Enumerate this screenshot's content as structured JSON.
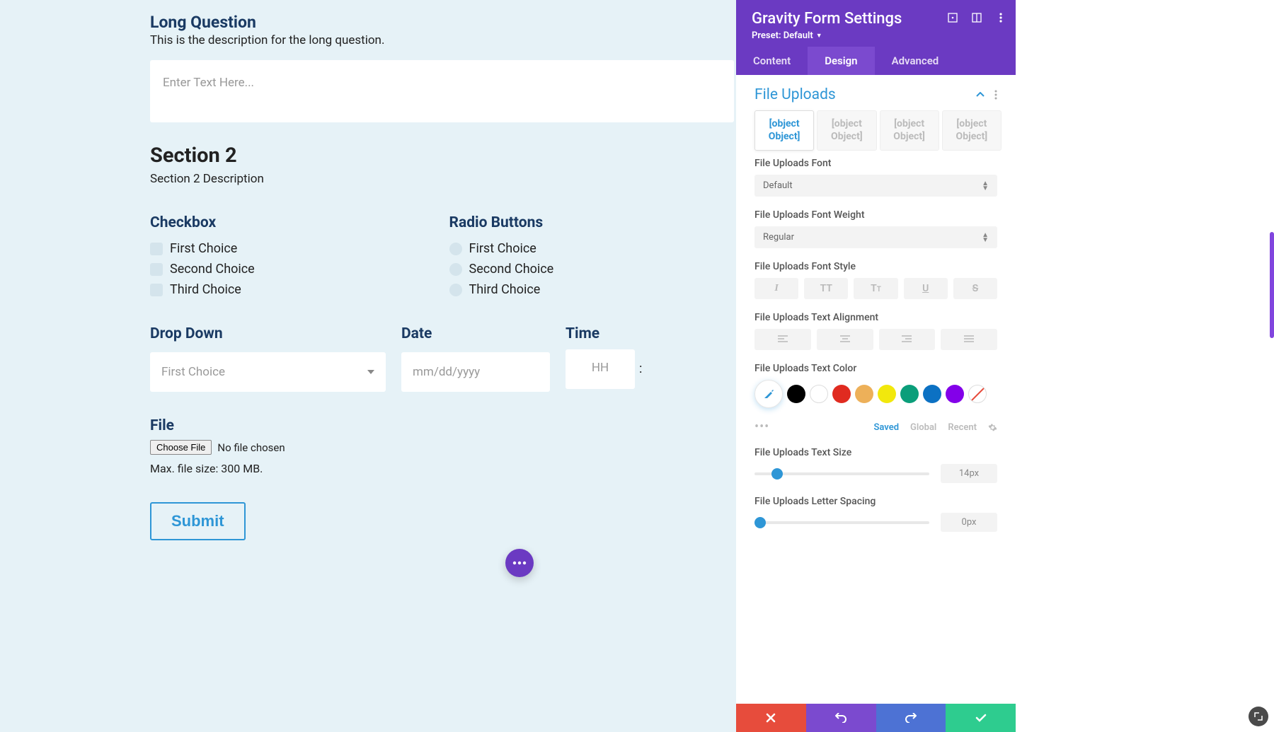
{
  "form": {
    "long_q_title": "Long Question",
    "long_q_desc": "This is the description for the long question.",
    "long_q_placeholder": "Enter Text Here...",
    "section2_title": "Section 2",
    "section2_desc": "Section 2 Description",
    "checkbox_label": "Checkbox",
    "checkbox_items": [
      "First Choice",
      "Second Choice",
      "Third Choice"
    ],
    "radio_label": "Radio Buttons",
    "radio_items": [
      "First Choice",
      "Second Choice",
      "Third Choice"
    ],
    "dropdown_label": "Drop Down",
    "dropdown_selected": "First Choice",
    "date_label": "Date",
    "date_placeholder": "mm/dd/yyyy",
    "time_label": "Time",
    "time_hh": "HH",
    "time_sep": ":",
    "file_label": "File",
    "file_button": "Choose File",
    "file_none": "No file chosen",
    "file_note": "Max. file size: 300 MB.",
    "submit": "Submit"
  },
  "panel": {
    "title": "Gravity Form Settings",
    "preset_label": "Preset: Default",
    "tabs": {
      "content": "Content",
      "design": "Design",
      "advanced": "Advanced"
    },
    "section_title": "File Uploads",
    "obj_tabs": [
      "[object Object]",
      "[object Object]",
      "[object Object]",
      "[object Object]"
    ],
    "font_label": "File Uploads Font",
    "font_value": "Default",
    "weight_label": "File Uploads Font Weight",
    "weight_value": "Regular",
    "style_label": "File Uploads Font Style",
    "align_label": "File Uploads Text Alignment",
    "color_label": "File Uploads Text Color",
    "color_tabs": {
      "saved": "Saved",
      "global": "Global",
      "recent": "Recent"
    },
    "size_label": "File Uploads Text Size",
    "size_value": "14px",
    "spacing_label": "File Uploads Letter Spacing",
    "spacing_value": "0px",
    "swatches": [
      "#000000",
      "#ffffff",
      "#e02b20",
      "#edb059",
      "#f2e80c",
      "#0b9e7a",
      "#0c71c3",
      "#8300e9"
    ]
  }
}
